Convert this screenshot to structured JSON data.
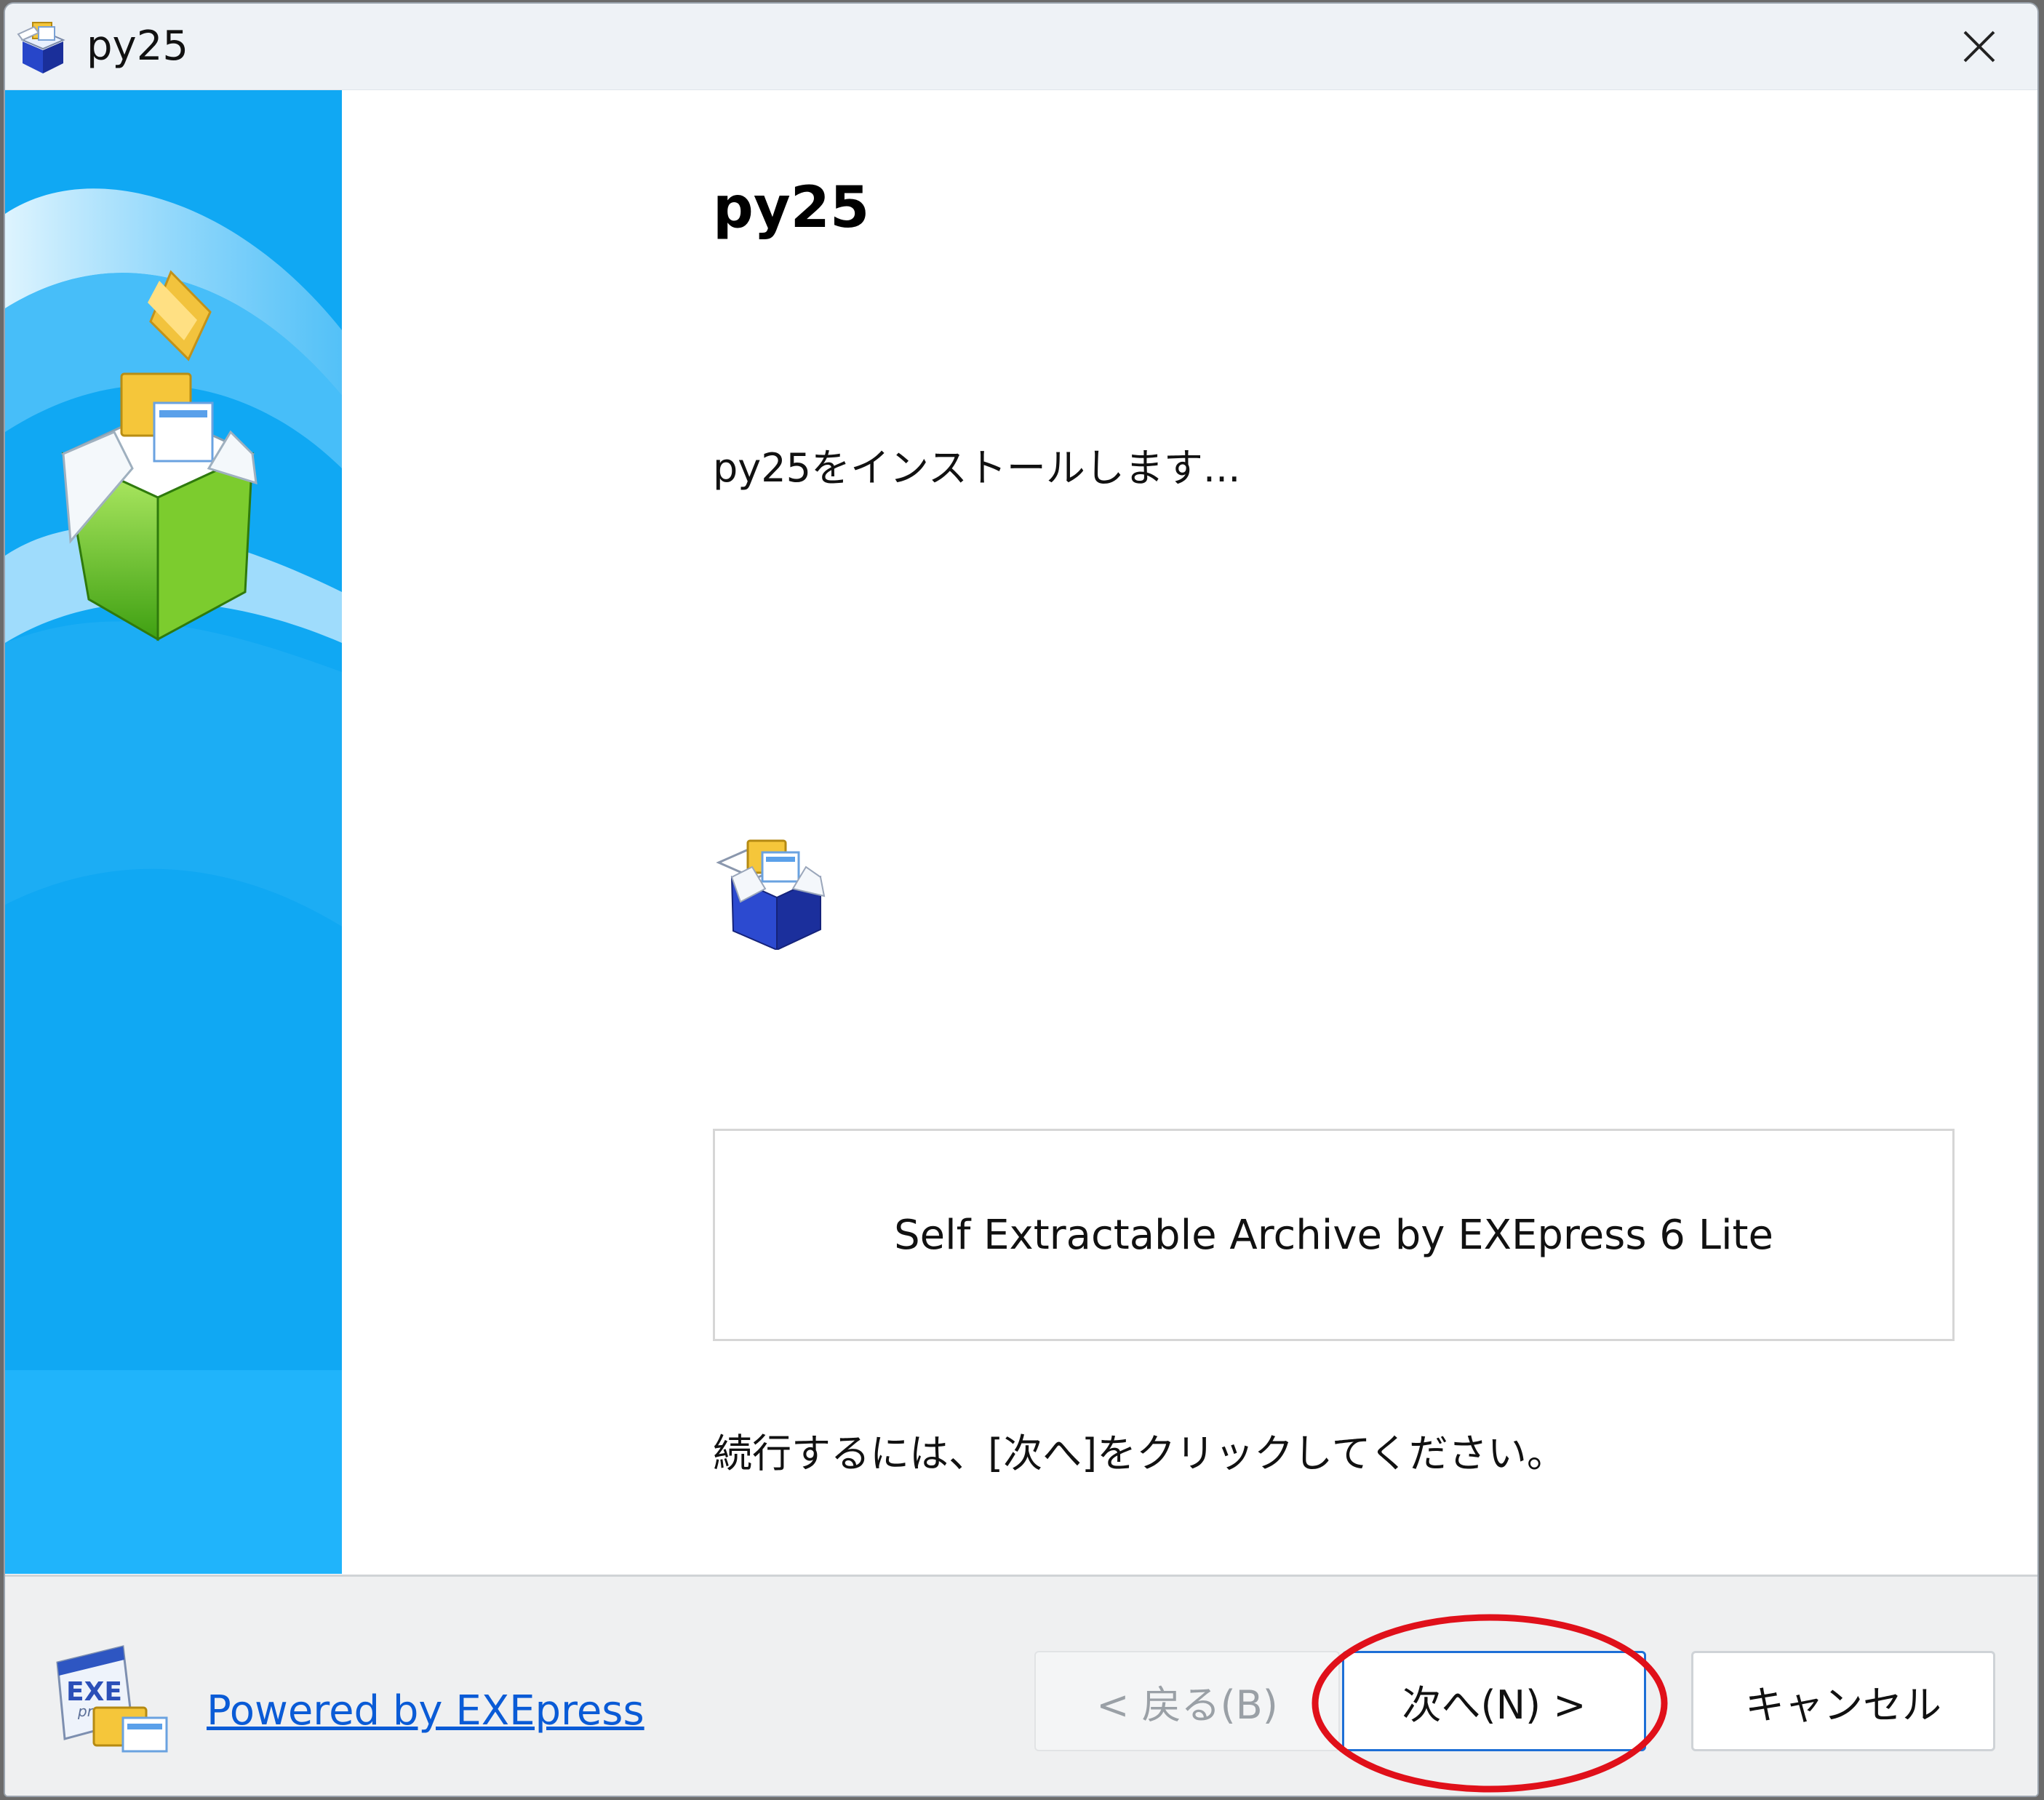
{
  "window": {
    "title": "py25",
    "title_icon": "installer-box-icon",
    "close_icon": "close-icon"
  },
  "banner": {
    "icon": "open-box-with-folders-icon"
  },
  "content": {
    "heading": "py25",
    "intro_text": "py25をインストールします...",
    "archive_text": "Self Extractable Archive by EXEpress 6 Lite",
    "instruction_text": "続行するには、[次へ]をクリックしてください。"
  },
  "footer": {
    "powered_link": "Powered by EXEpress",
    "logo_text": "EXE",
    "logo_subtext": "press",
    "back_button": "< 戻る(B)",
    "next_button": "次へ(N) >",
    "cancel_button": "キャンセル"
  },
  "colors": {
    "banner_blue": "#10a8f3",
    "link_blue": "#0a5bd6",
    "focus_border": "#1d6fd6",
    "annotation_red": "#e0101a"
  }
}
